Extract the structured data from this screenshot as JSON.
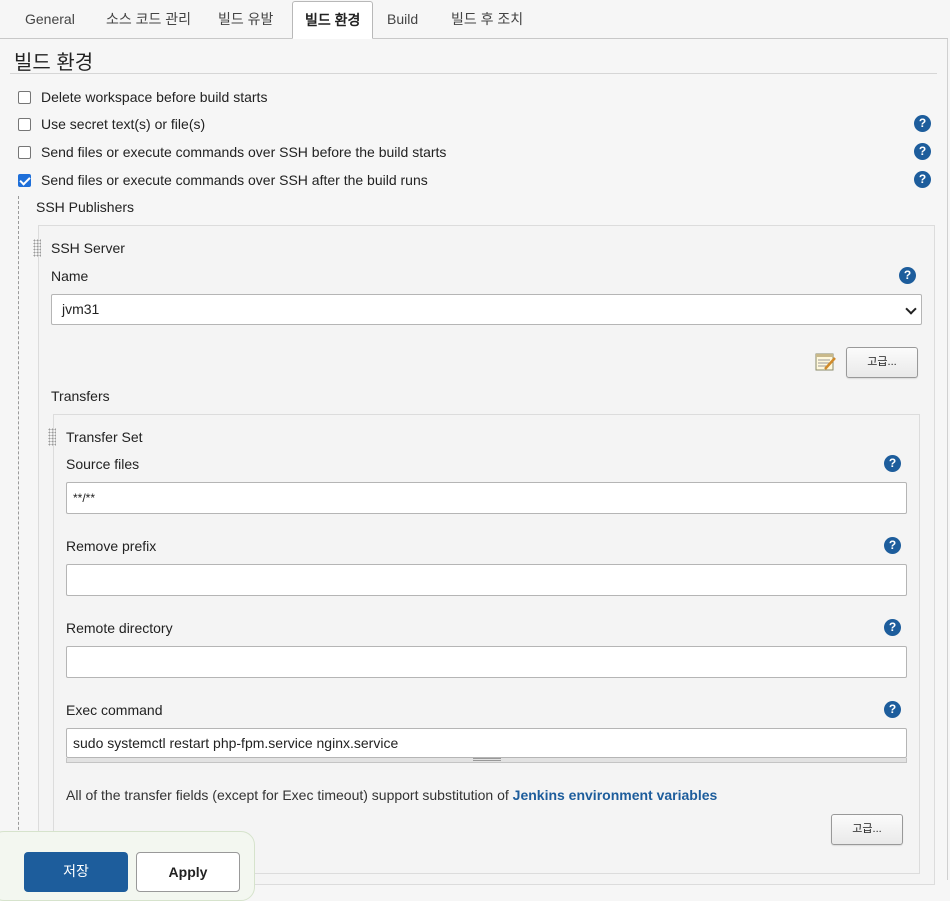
{
  "tabs": [
    {
      "label": "General"
    },
    {
      "label": "소스 코드 관리"
    },
    {
      "label": "빌드 유발"
    },
    {
      "label": "빌드 환경"
    },
    {
      "label": "Build"
    },
    {
      "label": "빌드 후 조치"
    }
  ],
  "active_tab": "빌드 환경",
  "section_title": "빌드 환경",
  "options": [
    {
      "label": "Delete workspace before build starts",
      "checked": false
    },
    {
      "label": "Use secret text(s) or file(s)",
      "checked": false
    },
    {
      "label": "Send files or execute commands over SSH before the build starts",
      "checked": false
    },
    {
      "label": "Send files or execute commands over SSH after the build runs",
      "checked": true
    }
  ],
  "help_glyph": "?",
  "ssh": {
    "publishers_label": "SSH Publishers",
    "server_label": "SSH Server",
    "name_label": "Name",
    "name_value": "jvm31",
    "advanced_label": "고급...",
    "transfers_label": "Transfers",
    "transfer_set_label": "Transfer Set",
    "source_files_label": "Source files",
    "source_files_value": "**/**",
    "remove_prefix_label": "Remove prefix",
    "remove_prefix_value": "",
    "remote_directory_label": "Remote directory",
    "remote_directory_value": "",
    "exec_command_label": "Exec command",
    "exec_command_value": "sudo systemctl restart php-fpm.service nginx.service",
    "note_text": "All of the transfer fields (except for Exec timeout) support substitution of ",
    "note_link": "Jenkins environment variables",
    "transfer_advanced_label": "고급..."
  },
  "footer": {
    "save_label": "저장",
    "apply_label": "Apply"
  },
  "colors": {
    "accent": "#1d5d9c",
    "checkbox": "#1e6fd9"
  }
}
